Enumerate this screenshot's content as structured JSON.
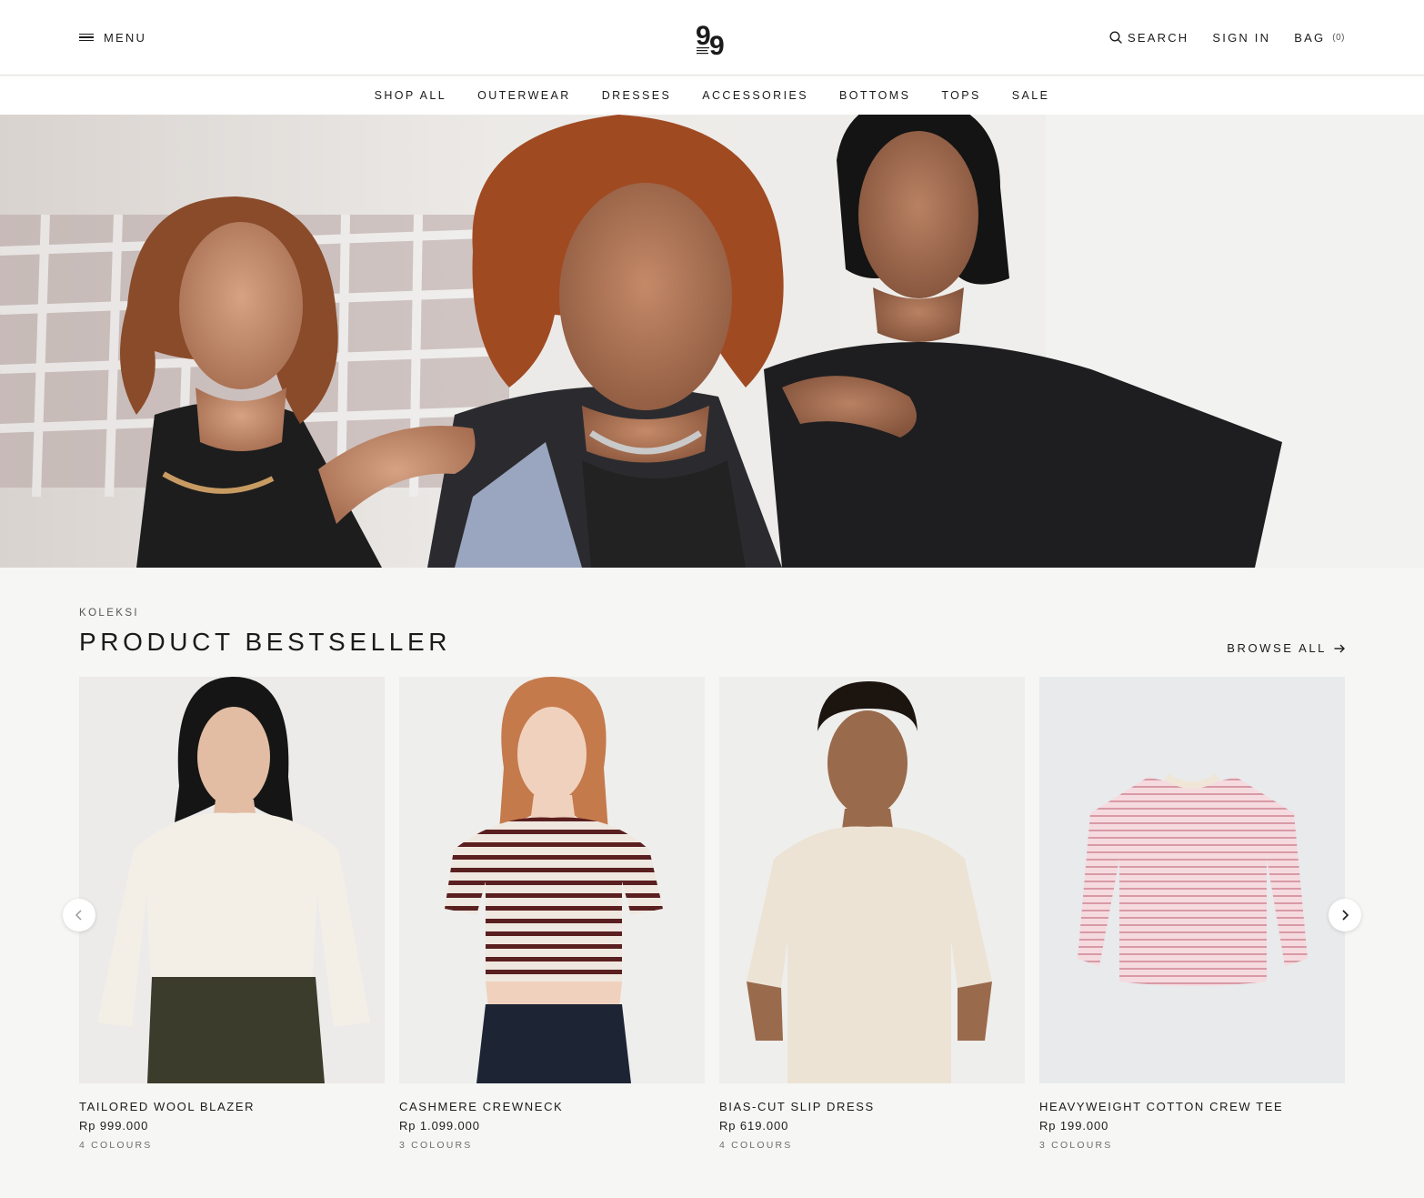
{
  "header": {
    "menu_label": "MENU",
    "search_label": "SEARCH",
    "signin_label": "SIGN IN",
    "bag_label": "BAG",
    "bag_count": "(0)"
  },
  "nav": {
    "items": [
      "SHOP ALL",
      "OUTERWEAR",
      "DRESSES",
      "ACCESSORIES",
      "BOTTOMS",
      "TOPS",
      "SALE"
    ]
  },
  "collection": {
    "eyebrow": "KOLEKSI",
    "title": "PRODUCT BESTSELLER",
    "browse_all": "BROWSE ALL",
    "products": [
      {
        "name": "TAILORED WOOL BLAZER",
        "price": "Rp 999.000",
        "colours": "4 COLOURS"
      },
      {
        "name": "CASHMERE CREWNECK",
        "price": "Rp 1.099.000",
        "colours": "3 COLOURS"
      },
      {
        "name": "BIAS-CUT SLIP DRESS",
        "price": "Rp 619.000",
        "colours": "4 COLOURS"
      },
      {
        "name": "HEAVYWEIGHT COTTON CREW TEE",
        "price": "Rp 199.000",
        "colours": "3 COLOURS"
      }
    ]
  },
  "icons": {
    "menu": "hamburger-icon",
    "search": "search-icon",
    "browse_arrow": "arrow-right-icon",
    "prev": "chevron-left-icon",
    "next": "chevron-right-icon"
  },
  "colors": {
    "text": "#1b1b1b",
    "page_background": "#f6f6f4",
    "header_background": "#ffffff",
    "muted_text": "#6d6d6d"
  }
}
